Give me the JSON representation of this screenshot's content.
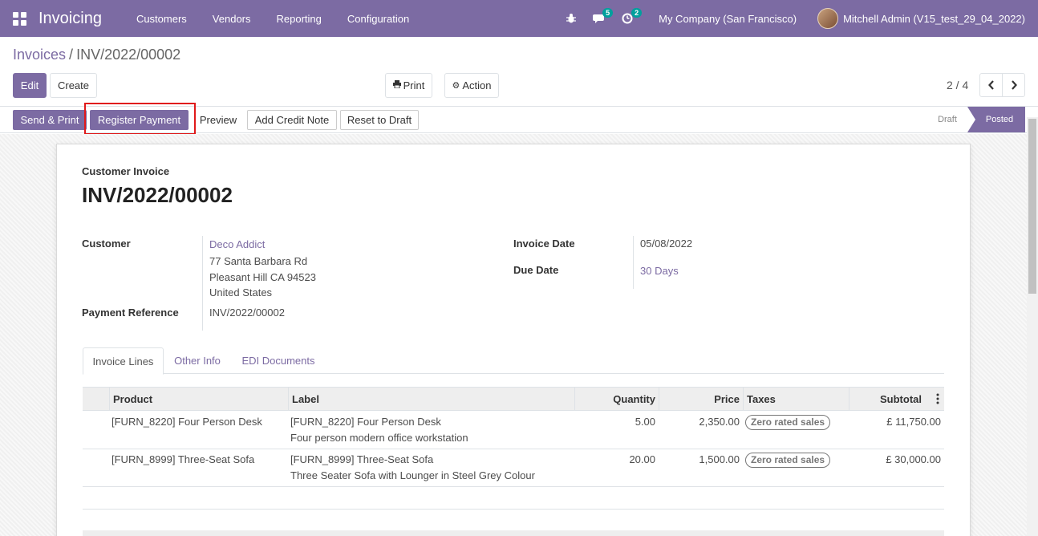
{
  "navbar": {
    "brand": "Invoicing",
    "menu": [
      "Customers",
      "Vendors",
      "Reporting",
      "Configuration"
    ],
    "chat_badge": "5",
    "activity_badge": "2",
    "company": "My Company (San Francisco)",
    "user": "Mitchell Admin (V15_test_29_04_2022)"
  },
  "breadcrumb": {
    "parent": "Invoices",
    "separator": "/",
    "current": "INV/2022/00002"
  },
  "toolbar": {
    "edit": "Edit",
    "create": "Create",
    "print": "Print",
    "action": "Action",
    "pager": "2 / 4"
  },
  "statusbar": {
    "send_print": "Send & Print",
    "register_payment": "Register Payment",
    "preview": "Preview",
    "add_credit_note": "Add Credit Note",
    "reset_to_draft": "Reset to Draft",
    "stage_draft": "Draft",
    "stage_posted": "Posted"
  },
  "document": {
    "type": "Customer Invoice",
    "name": "INV/2022/00002",
    "customer_label": "Customer",
    "customer_name": "Deco Addict",
    "address_line1": "77 Santa Barbara Rd",
    "address_line2": "Pleasant Hill CA 94523",
    "address_line3": "United States",
    "payment_ref_label": "Payment Reference",
    "payment_ref": "INV/2022/00002",
    "invoice_date_label": "Invoice Date",
    "invoice_date": "05/08/2022",
    "due_date_label": "Due Date",
    "due_date": "30 Days"
  },
  "tabs": [
    "Invoice Lines",
    "Other Info",
    "EDI Documents"
  ],
  "table": {
    "headers": [
      "Product",
      "Label",
      "Quantity",
      "Price",
      "Taxes",
      "Subtotal"
    ],
    "rows": [
      {
        "product": "[FURN_8220] Four Person Desk",
        "label": "[FURN_8220] Four Person Desk",
        "description": "Four person modern office workstation",
        "quantity": "5.00",
        "price": "2,350.00",
        "tax": "Zero rated sales",
        "subtotal": "£ 11,750.00"
      },
      {
        "product": "[FURN_8999] Three-Seat Sofa",
        "label": "[FURN_8999] Three-Seat Sofa",
        "description": "Three Seater Sofa with Lounger in Steel Grey Colour",
        "quantity": "20.00",
        "price": "1,500.00",
        "tax": "Zero rated sales",
        "subtotal": "£ 30,000.00"
      }
    ]
  },
  "colors": {
    "primary": "#7c6ba3",
    "highlight": "#e0191a"
  }
}
